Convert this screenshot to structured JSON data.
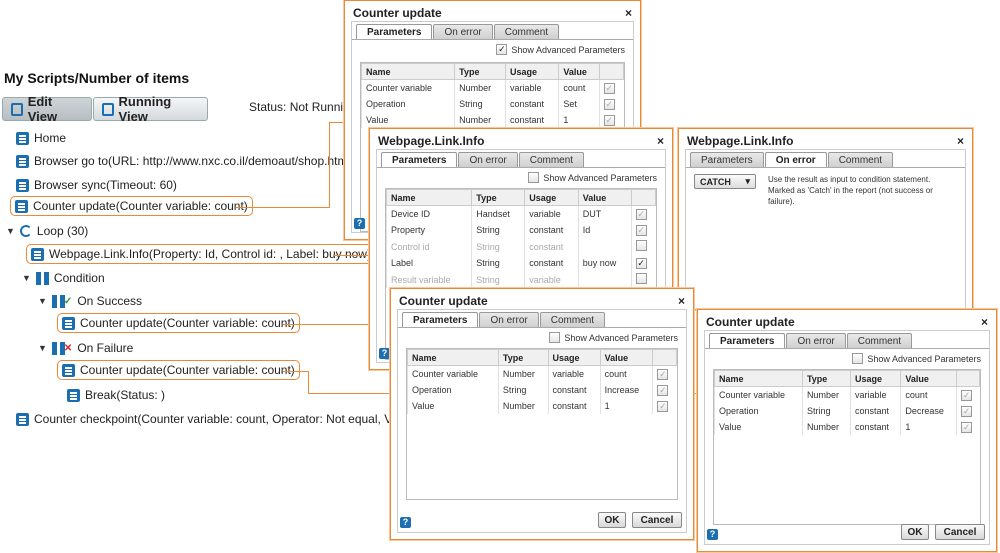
{
  "page_title": "My Scripts/Number of items",
  "views": {
    "edit": "Edit View",
    "running": "Running View"
  },
  "status": "Status: Not Running",
  "tree": {
    "home": "Home",
    "browser_goto": "Browser go to(URL: http://www.nxc.co.il/demoaut/shop.html)",
    "browser_sync": "Browser sync(Timeout: 60)",
    "counter_update_1": "Counter update(Counter variable: count)",
    "loop": "Loop (30)",
    "webpage_link": "Webpage.Link.Info(Property: Id, Control id: , Label: buy now)",
    "condition": "Condition",
    "on_success": "On Success",
    "counter_update_2": "Counter update(Counter variable: count)",
    "on_failure": "On Failure",
    "counter_update_3": "Counter update(Counter variable: count)",
    "break": "Break(Status: )",
    "checkpoint": "Counter checkpoint(Counter variable: count, Operator: Not equal, Value: 0)"
  },
  "common": {
    "tabs": [
      "Parameters",
      "On error",
      "Comment"
    ],
    "show_advanced": "Show Advanced Parameters",
    "headers": [
      "Name",
      "Type",
      "Usage",
      "Value"
    ],
    "ok": "OK",
    "cancel": "Cancel",
    "help": "?",
    "close": "×"
  },
  "dialog_top": {
    "title": "Counter update",
    "rows": [
      [
        "Counter variable",
        "Number",
        "variable",
        "count"
      ],
      [
        "Operation",
        "String",
        "constant",
        "Set"
      ],
      [
        "Value",
        "Number",
        "constant",
        "1"
      ]
    ]
  },
  "dialog_webpage": {
    "title": "Webpage.Link.Info",
    "rows": [
      [
        "Device ID",
        "Handset",
        "variable",
        "DUT"
      ],
      [
        "Property",
        "String",
        "constant",
        "Id"
      ],
      [
        "Control id",
        "String",
        "constant",
        ""
      ],
      [
        "Label",
        "String",
        "constant",
        "buy now"
      ],
      [
        "Result variable",
        "String",
        "variable",
        ""
      ]
    ]
  },
  "dialog_onerror": {
    "title": "Webpage.Link.Info",
    "catch": "CATCH",
    "description": "Use the result as input to condition statement. Marked as 'Catch' in the report (not success or failure)."
  },
  "dialog_increase": {
    "title": "Counter update",
    "rows": [
      [
        "Counter variable",
        "Number",
        "variable",
        "count"
      ],
      [
        "Operation",
        "String",
        "constant",
        "Increase"
      ],
      [
        "Value",
        "Number",
        "constant",
        "1"
      ]
    ]
  },
  "dialog_decrease": {
    "title": "Counter update",
    "rows": [
      [
        "Counter variable",
        "Number",
        "variable",
        "count"
      ],
      [
        "Operation",
        "String",
        "constant",
        "Decrease"
      ],
      [
        "Value",
        "Number",
        "constant",
        "1"
      ]
    ]
  }
}
